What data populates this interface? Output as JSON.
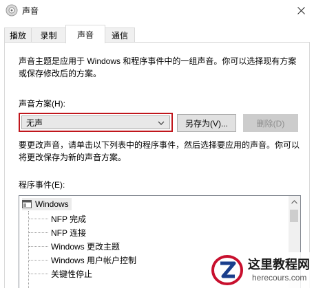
{
  "window": {
    "title": "声音",
    "icon": "speaker-icon",
    "close_icon": "close-icon"
  },
  "tabs": [
    {
      "label": "播放",
      "active": false
    },
    {
      "label": "录制",
      "active": false
    },
    {
      "label": "声音",
      "active": true
    },
    {
      "label": "通信",
      "active": false
    }
  ],
  "sounds_tab": {
    "description": "声音主题是应用于 Windows 和程序事件中的一组声音。你可以选择现有方案或保存修改后的方案。",
    "scheme_label": "声音方案(H):",
    "scheme_selected": "无声",
    "save_as_label": "另存为(V)...",
    "delete_label": "删除(D)",
    "change_description": "要更改声音，请单击以下列表中的程序事件，然后选择要应用的声音。你可以将更改保存为新的声音方案。",
    "events_label": "程序事件(E):",
    "events_root": "Windows",
    "events": [
      "NFP 完成",
      "NFP 连接",
      "Windows 更改主题",
      "Windows 用户帐户控制",
      "关键性停止"
    ]
  },
  "watermark": {
    "title": "这里教程网",
    "url": "herecours.com"
  },
  "colors": {
    "highlight_border": "#c0161c",
    "disabled_text": "#8c8c8c"
  }
}
